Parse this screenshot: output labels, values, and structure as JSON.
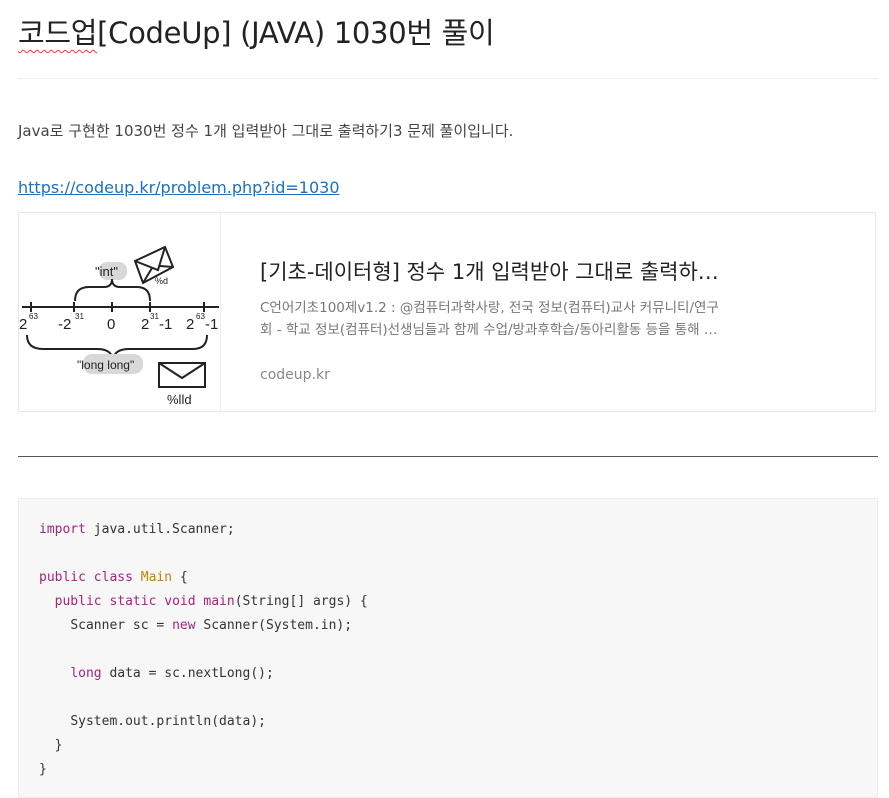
{
  "post": {
    "title_prefix": "코드업",
    "title_rest": "[CodeUp] (JAVA) 1030번 풀이",
    "intro": "Java로 구현한 1030번 정수 1개 입력받아 그대로 출력하기3 문제 풀이입니다.",
    "link": "https://codeup.kr/problem.php?id=1030"
  },
  "card": {
    "title": "[기초-데이터형] 정수 1개 입력받아 그대로 출력하…",
    "desc_line1": "C언어기초100제v1.2 : @컴퓨터과학사랑, 전국 정보(컴퓨터)교사 커뮤니티/연구",
    "desc_line2": "회 - 학교 정보(컴퓨터)선생님들과 함께 수업/방과후학습/동아리활동 등을 통해 …",
    "domain": "codeup.kr",
    "thumb": {
      "int": "\"int\"",
      "pct_d": "%d",
      "longlong": "\"long long\"",
      "pct_lld": "%lld",
      "t1": "2",
      "t1s": "63",
      "t2": "-2",
      "t2s": "31",
      "t3": "0",
      "t4": "2",
      "t4s": "31",
      "t4e": "-1",
      "t5": "2",
      "t5s": "63",
      "t5e": "-1"
    }
  },
  "code": {
    "l1_kw": "import",
    "l1_rest": " java.util.Scanner;",
    "l2_kw1": "public",
    "l2_kw2": "class",
    "l2_cls": "Main",
    "l2_rest": " {",
    "l3_kw1": "public",
    "l3_kw2": "static",
    "l3_kw3": "void",
    "l3_fn": "main",
    "l3_rest": "(String[] args) {",
    "l4_a": "Scanner sc = ",
    "l4_kw": "new",
    "l4_b": " Scanner(System.in);",
    "l5_kw": "long",
    "l5_rest": " data = sc.nextLong();",
    "l6": "System.out.println(data);",
    "l7": "}",
    "l8": "}"
  }
}
